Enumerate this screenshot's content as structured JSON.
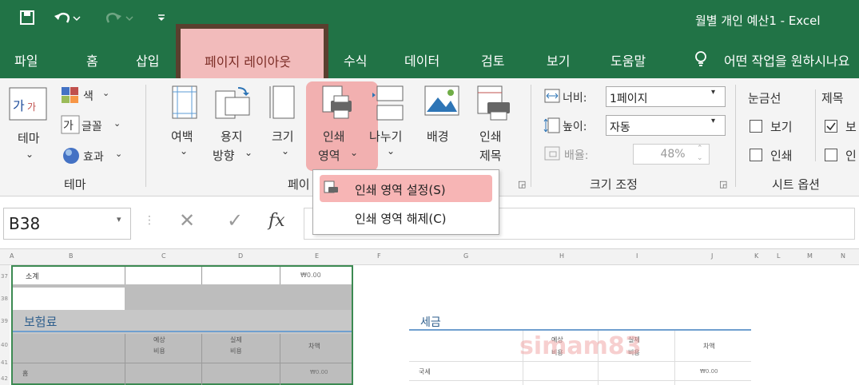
{
  "title_bar": {
    "window_title": "월별 개인 예산1 - Excel"
  },
  "ribbon_tabs": [
    "파일",
    "홈",
    "삽입",
    "페이지 레이아웃",
    "수식",
    "데이터",
    "검토",
    "보기",
    "도움말"
  ],
  "active_tab": "페이지 레이아웃",
  "tell_me": "어떤 작업을 원하시나요",
  "groups": {
    "themes": {
      "label": "테마",
      "theme_btn": "테마",
      "colors": "색",
      "fonts": "글꼴",
      "effects": "효과"
    },
    "page_setup": {
      "label": "페이지 설정",
      "label_visible": "페이",
      "margins": "여백",
      "orientation_line1": "용지",
      "orientation_line2": "방향",
      "size": "크기",
      "print_area_line1": "인쇄",
      "print_area_line2": "영역",
      "breaks": "나누기",
      "background": "배경",
      "print_titles_line1": "인쇄",
      "print_titles_line2": "제목"
    },
    "scale_to_fit": {
      "label": "크기 조정",
      "width_label": "너비:",
      "width_value": "1페이지",
      "height_label": "높이:",
      "height_value": "자동",
      "scale_label": "배율:",
      "scale_value": "48%"
    },
    "sheet_options": {
      "label": "시트 옵션",
      "gridlines": "눈금선",
      "headings": "제목",
      "view": "보기",
      "print": "인쇄",
      "view2": "보",
      "print2": "인"
    }
  },
  "print_area_menu": {
    "set": "인쇄 영역 설정(S)",
    "clear": "인쇄 영역 해제(C)"
  },
  "formula_bar": {
    "name_box": "B38",
    "fx": "fx"
  },
  "columns": [
    "A",
    "B",
    "C",
    "D",
    "E",
    "F",
    "G",
    "H",
    "I",
    "J",
    "K",
    "L",
    "M",
    "N"
  ],
  "rows": [
    "37",
    "38",
    "39",
    "40",
    "41",
    "42"
  ],
  "sheet": {
    "subtotal_label": "소계",
    "subtotal_value": "₩0.00",
    "insurance_title": "보험료",
    "expected": [
      "예상",
      "비용"
    ],
    "actual": [
      "실제",
      "비용"
    ],
    "difference": "차액",
    "home": "홈",
    "home_value": "₩0.00",
    "tax_title": "세금",
    "national_tax": "국세",
    "national_tax_value": "₩0.00",
    "watermark": "simam83"
  },
  "colors": {
    "excel_green": "#217346",
    "highlight": "#f07878",
    "print_area_border": "#3c8a52"
  }
}
